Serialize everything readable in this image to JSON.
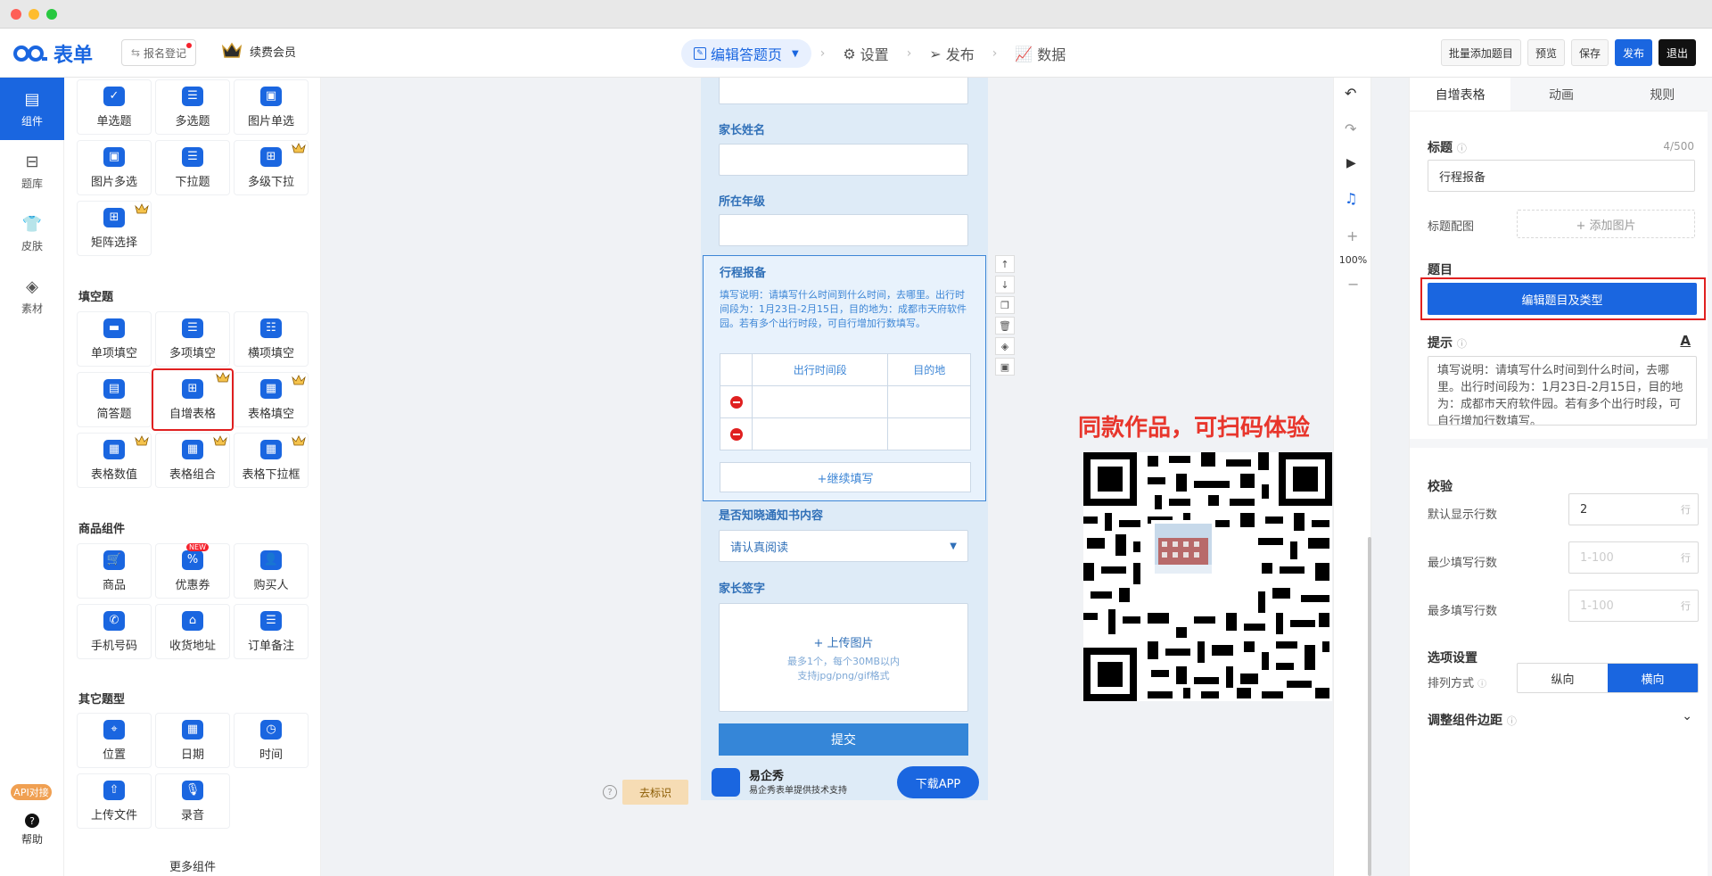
{
  "topbar": {
    "logo_text": "表单",
    "register_button": "报名登记",
    "vip_label": "续费会员",
    "steps": [
      "编辑答题页",
      "设置",
      "发布",
      "数据"
    ],
    "buttons": {
      "batch_add": "批量添加题目",
      "preview": "预览",
      "save": "保存",
      "publish": "发布",
      "exit": "退出"
    }
  },
  "nav": {
    "items": [
      "组件",
      "题库",
      "皮肤",
      "素材"
    ],
    "api_badge": "API对接",
    "help": "帮助"
  },
  "panel": {
    "choice_items": [
      "单选题",
      "多选题",
      "图片单选",
      "图片多选",
      "下拉题",
      "多级下拉",
      "矩阵选择"
    ],
    "fill_title": "填空题",
    "fill_items": [
      "单项填空",
      "多项填空",
      "横项填空",
      "简答题",
      "自增表格",
      "表格填空",
      "表格数值",
      "表格组合",
      "表格下拉框"
    ],
    "goods_title": "商品组件",
    "goods_items": [
      "商品",
      "优惠券",
      "购买人",
      "手机号码",
      "收货地址",
      "订单备注"
    ],
    "new_tag": "NEW",
    "other_title": "其它题型",
    "other_items": [
      "位置",
      "日期",
      "时间",
      "上传文件",
      "录音"
    ],
    "more": "更多组件"
  },
  "form": {
    "parent_name_label": "家长姓名",
    "grade_label": "所在年级",
    "trip_title": "行程报备",
    "trip_desc": "填写说明：请填写什么时间到什么时间，去哪里。出行时间段为：1月23日-2月15日，目的地为：成都市天府软件园。若有多个出行时段，可自行增加行数填写。",
    "table_headers": [
      "出行时间段",
      "目的地"
    ],
    "continue_button": "+继续填写",
    "notice_label": "是否知晓通知书内容",
    "notice_select": "请认真阅读",
    "sign_label": "家长签字",
    "upload_text": "+ 上传图片",
    "upload_hint1": "最多1个，每个30MB以内",
    "upload_hint2": "支持jpg/png/gif格式",
    "submit": "提交",
    "footer_brand": "易企秀",
    "footer_sub": "易企秀表单提供技术支持",
    "download_app": "下载APP",
    "remove_mark": "去标识"
  },
  "tools": {
    "zoom": "100%"
  },
  "promo": {
    "title": "同款作品，可扫码体验"
  },
  "props": {
    "tabs": [
      "自增表格",
      "动画",
      "规则"
    ],
    "title_label": "标题",
    "title_count": "4/500",
    "title_value": "行程报备",
    "title_image_label": "标题配图",
    "add_image": "+ 添加图片",
    "question_label": "题目",
    "edit_button": "编辑题目及类型",
    "hint_label": "提示",
    "hint_text": "填写说明：请填写什么时间到什么时间，去哪里。出行时间段为：1月23日-2月15日，目的地为：成都市天府软件园。若有多个出行时段，可自行增加行数填写。",
    "validate_label": "校验",
    "default_rows_label": "默认显示行数",
    "default_rows_value": "2",
    "min_rows_label": "最少填写行数",
    "max_rows_label": "最多填写行数",
    "range_placeholder": "1-100",
    "row_unit": "行",
    "option_label": "选项设置",
    "arrange_label": "排列方式",
    "arrange_options": [
      "纵向",
      "横向"
    ],
    "margin_label": "调整组件边距"
  },
  "colors": {
    "accent": "#1a66e0",
    "highlight": "#e02020",
    "form_bg": "#deebf7",
    "form_text": "#3d86d6",
    "promo": "#e8362c"
  }
}
